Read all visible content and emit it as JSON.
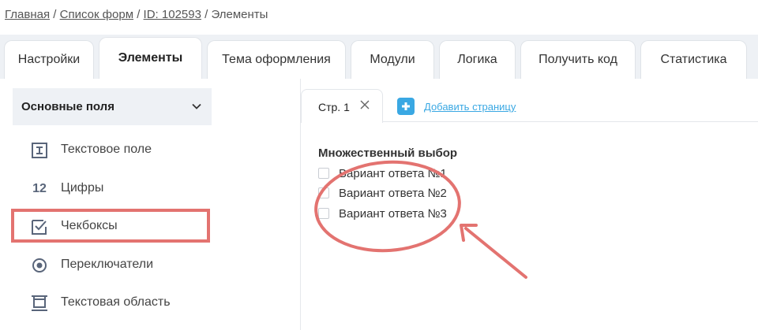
{
  "breadcrumb": {
    "home": "Главная",
    "forms": "Список форм",
    "id": "ID: 102593",
    "current": "Элементы",
    "separator": "/"
  },
  "tabs": [
    {
      "label": "Настройки"
    },
    {
      "label": "Элементы",
      "active": true
    },
    {
      "label": "Тема оформления"
    },
    {
      "label": "Модули"
    },
    {
      "label": "Логика"
    },
    {
      "label": "Получить код"
    },
    {
      "label": "Статистика"
    }
  ],
  "sidebar": {
    "section_title": "Основные поля",
    "items": [
      {
        "label": "Текстовое поле",
        "icon": "text-field-icon"
      },
      {
        "label": "Цифры",
        "icon": "numbers-icon",
        "icon_text": "12"
      },
      {
        "label": "Чекбоксы",
        "icon": "checkbox-icon",
        "highlighted": true
      },
      {
        "label": "Переключатели",
        "icon": "radio-icon"
      },
      {
        "label": "Текстовая область",
        "icon": "textarea-icon"
      }
    ]
  },
  "pages": {
    "tab_label": "Стр. 1",
    "add_label": "Добавить страницу"
  },
  "question": {
    "title": "Множественный выбор",
    "options": [
      {
        "label": "Вариант ответа №1",
        "checked": false
      },
      {
        "label": "Вариант ответа №2",
        "checked": false
      },
      {
        "label": "Вариант ответа №3",
        "checked": false
      }
    ]
  },
  "colors": {
    "accent": "#3aa8e3",
    "annotation": "#e37370",
    "tab_bar": "#eef1f5",
    "icon": "#59657a"
  }
}
